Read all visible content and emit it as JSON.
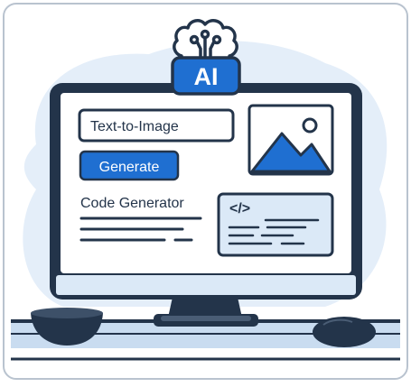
{
  "badge": {
    "label": "AI"
  },
  "screen": {
    "text_to_image_label": "Text-to-Image",
    "generate_button_label": "Generate",
    "code_generator_label": "Code Generator",
    "code_tag": "</>"
  },
  "colors": {
    "accent": "#1f6fd1",
    "dark": "#23344a",
    "light_blue": "#dbe9f7",
    "blob": "#e4eef9"
  }
}
